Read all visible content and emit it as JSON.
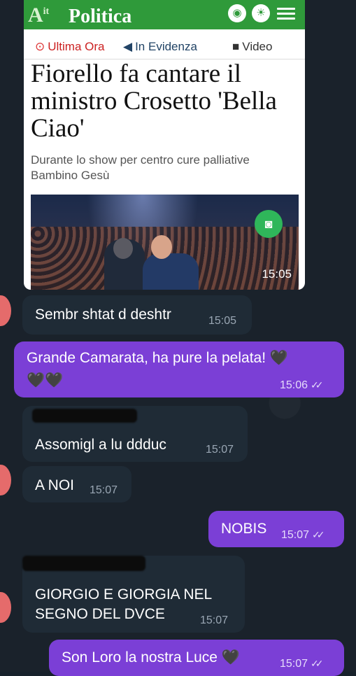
{
  "article": {
    "brand_logo": "At",
    "section": "Politica",
    "tabs": [
      {
        "icon": "clock-icon",
        "label": "Ultima Ora"
      },
      {
        "icon": "megaphone-icon",
        "label": "In Evidenza"
      },
      {
        "icon": "video-icon",
        "label": "Video"
      }
    ],
    "headline": "Fiorello fa cantare il ministro Crosetto 'Bella Ciao'",
    "subheadline": "Durante lo show per centro cure palliative Bambino Gesù",
    "time": "15:05"
  },
  "messages": [
    {
      "dir": "in",
      "text": "Sembr shtat d deshtr",
      "time": "15:05"
    },
    {
      "dir": "out",
      "text": "Grande Camarata, ha pure la pelata! 🖤",
      "text2": "🖤🖤",
      "time": "15:06"
    },
    {
      "dir": "in",
      "text": "Assomigl a lu ddduc",
      "time": "15:07"
    },
    {
      "dir": "in",
      "text": "A NOI",
      "time": "15:07"
    },
    {
      "dir": "out",
      "text": "NOBIS",
      "time": "15:07"
    },
    {
      "dir": "in",
      "text": "GIORGIO E GIORGIA NEL",
      "text2": "SEGNO DEL DVCE",
      "time": "15:07"
    },
    {
      "dir": "out",
      "text": "Son Loro la nostra Luce 🖤",
      "time": "15:07"
    }
  ],
  "colors": {
    "outgoing": "#7b3fd6",
    "incoming": "#1f2b36",
    "header": "#2f9a3a"
  }
}
